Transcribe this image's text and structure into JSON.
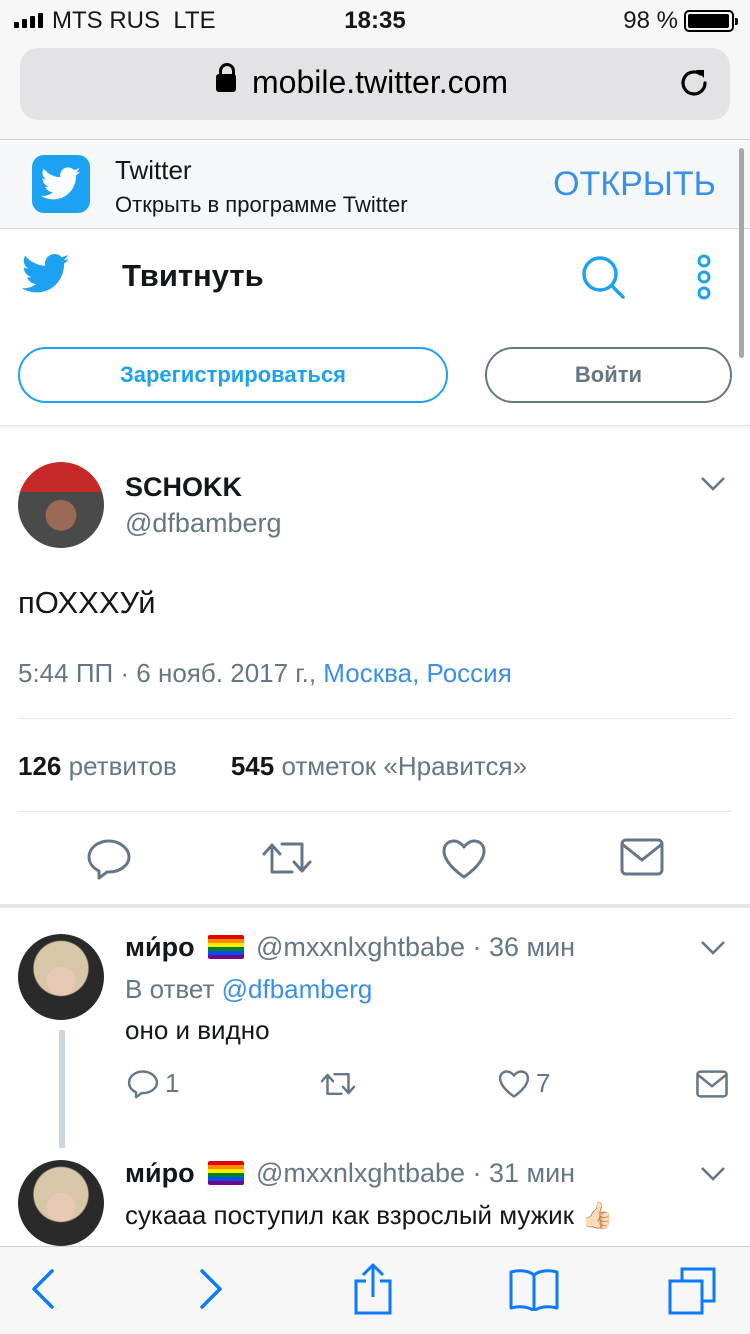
{
  "status_bar": {
    "carrier": "MTS RUS",
    "network": "LTE",
    "time": "18:35",
    "battery": "98 %",
    "battery_level": 0.98
  },
  "browser": {
    "url": "mobile.twitter.com"
  },
  "app_banner": {
    "name": "Twitter",
    "subtitle": "Открыть в программе Twitter",
    "open_label": "ОТКРЫТЬ"
  },
  "header": {
    "title": "Твитнуть",
    "signup_label": "Зарегистрироваться",
    "login_label": "Войти"
  },
  "tweet": {
    "name": "SCHOKK",
    "handle": "@dfbamberg",
    "text": "пОХХХУй",
    "time_date": "5:44 ПП · 6 нояб. 2017 г.,",
    "location": "Москва, Россия",
    "retweets_count": "126",
    "retweets_label": "ретвитов",
    "likes_count": "545",
    "likes_label": "отметок «Нравится»"
  },
  "replies": [
    {
      "name": "ми́ро",
      "handle": "@mxxnlxghtbabe · 36 мин",
      "reply_prefix": "В ответ",
      "reply_to": "@dfbamberg",
      "text": "оно и видно",
      "reply_count": "1",
      "like_count": "7"
    },
    {
      "name": "ми́ро",
      "handle": "@mxxnlxghtbabe · 31 мин",
      "text": "сукааа поступил как взрослый мужик 👍🏻"
    }
  ],
  "colors": {
    "twitter_blue": "#1da1f2",
    "link_blue": "#3a8fe8",
    "secondary_gray": "#657786"
  },
  "icons": [
    "twitter-bird-icon",
    "search-icon",
    "more-dots-icon",
    "chevron-down-icon",
    "reply-icon",
    "retweet-icon",
    "like-icon",
    "message-icon",
    "back-icon",
    "forward-icon",
    "share-icon",
    "bookmarks-icon",
    "tabs-icon",
    "lock-icon",
    "reload-icon"
  ]
}
